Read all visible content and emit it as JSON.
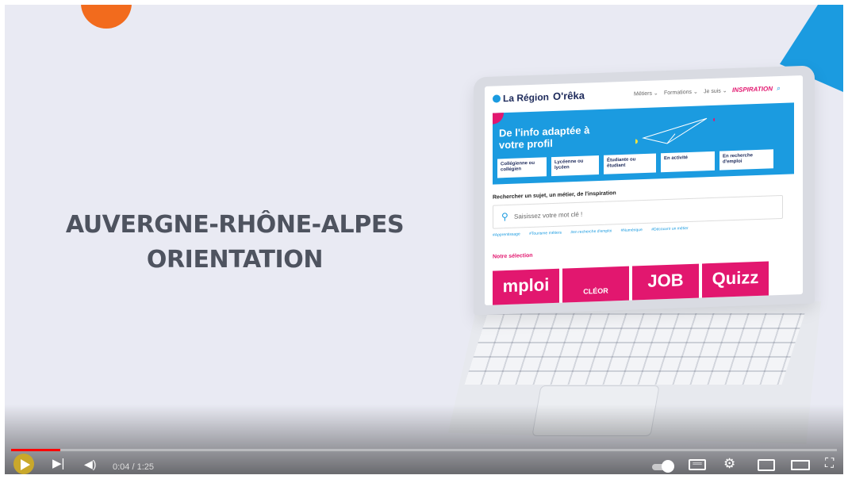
{
  "video": {
    "headline_line1": "AUVERGNE-RHÔNE-ALPES",
    "headline_line2": "ORIENTATION"
  },
  "site": {
    "logo_region": "La Région",
    "logo_oreka": "O'rêka",
    "nav": [
      "Métiers ⌄",
      "Formations ⌄",
      "Je suis ⌄"
    ],
    "nav_inspiration": "INSPIRATION",
    "hero_title": "De l'info adaptée à votre profil",
    "profiles": [
      "Collégienne ou collégien",
      "Lycéenne ou lycéen",
      "Étudiante ou étudiant",
      "En activité",
      "En recherche d'emploi"
    ],
    "search_label": "Rechercher un sujet, un métier, de l'inspiration",
    "search_placeholder": "Saisissez votre mot clé !",
    "tags": [
      "#Apprentissage",
      "#Tourisme métiers",
      "#en recherche d'emploi",
      "#Numérique",
      "#Découvrir un métier"
    ],
    "selection_label": "Notre sélection",
    "tiles": [
      "mploi",
      "CLÉOR",
      "JOB",
      "Quizz"
    ]
  },
  "player": {
    "time": "0:04 / 1:25",
    "progress_fraction": 0.06,
    "autoplay": "on"
  },
  "colors": {
    "brand_blue": "#1b9be0",
    "brand_pink": "#e2176f",
    "accent_orange": "#f26b1d",
    "progress_red": "#ff0000"
  }
}
